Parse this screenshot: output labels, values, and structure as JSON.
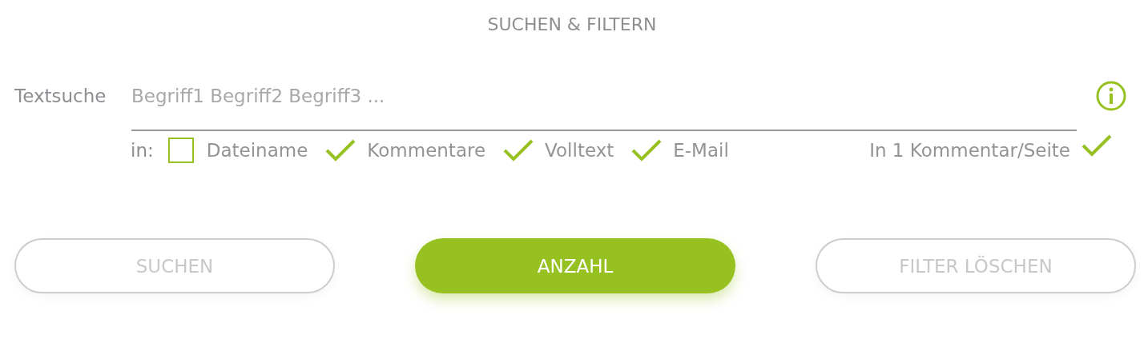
{
  "title": "SUCHEN & FILTERN",
  "search": {
    "label": "Textsuche",
    "placeholder": "Begriff1 Begriff2 Begriff3 ..."
  },
  "scope": {
    "label": "in:",
    "options": [
      {
        "label": "Dateiname",
        "checked": false
      },
      {
        "label": "Kommentare",
        "checked": true
      },
      {
        "label": "Volltext",
        "checked": true
      },
      {
        "label": "E-Mail",
        "checked": true
      }
    ],
    "single": {
      "label": "In 1 Kommentar/Seite",
      "checked": true
    }
  },
  "buttons": [
    {
      "label": "SUCHEN",
      "disabled": true
    },
    {
      "label": "ANZAHL",
      "disabled": false
    },
    {
      "label": "FILTER LÖSCHEN",
      "disabled": true
    }
  ]
}
